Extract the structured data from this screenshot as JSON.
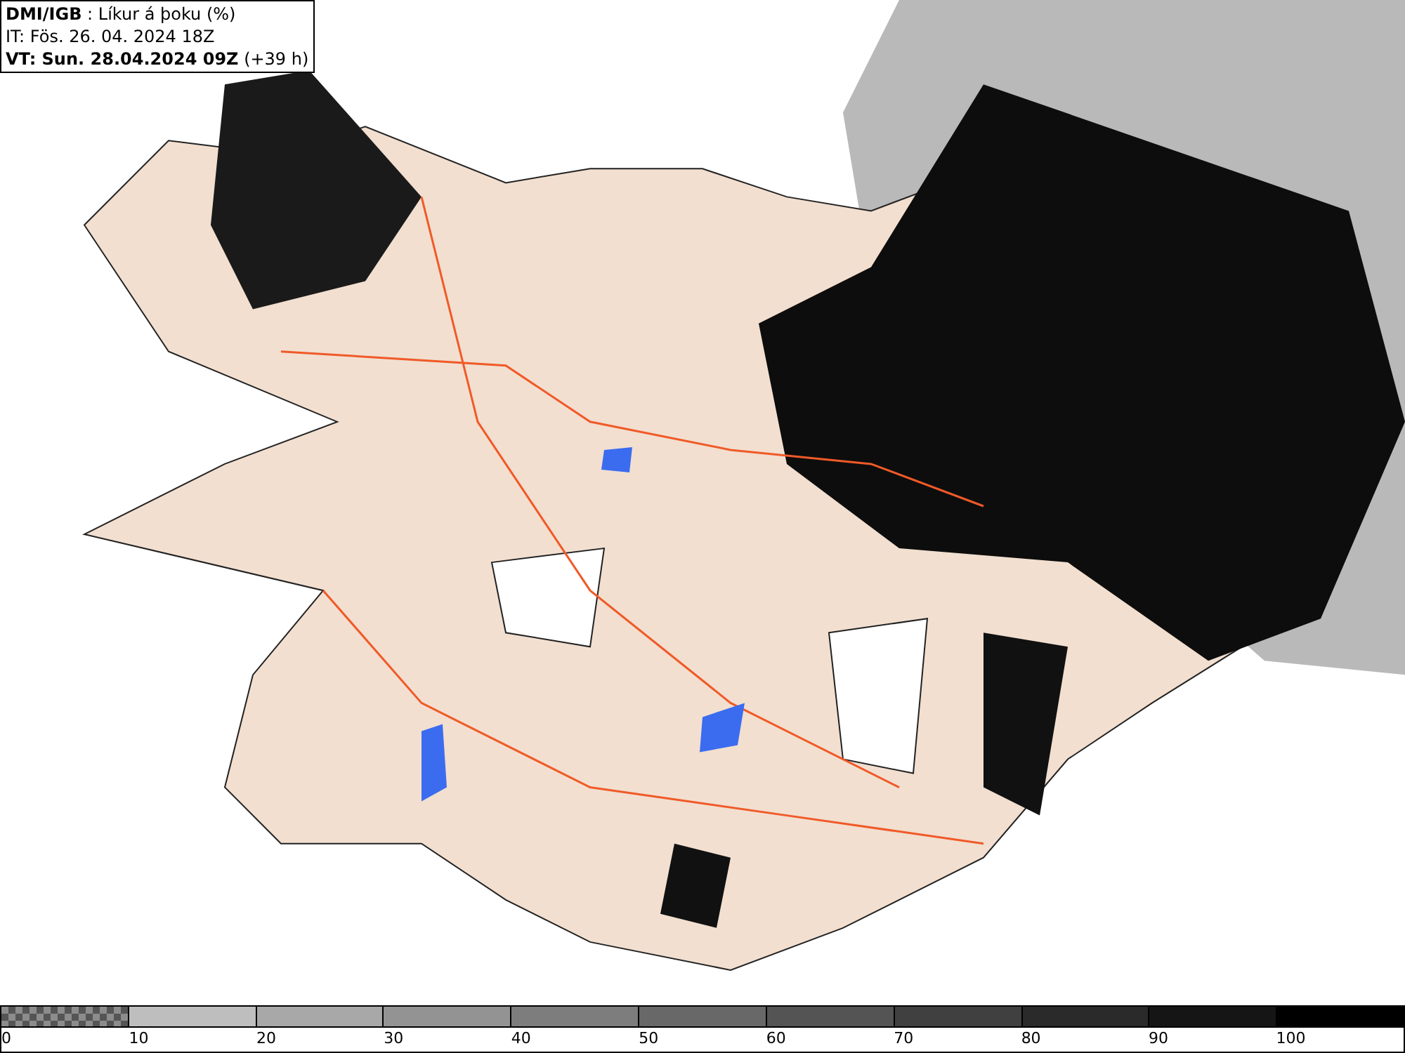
{
  "header": {
    "lines": [
      "**DMI/IGB** : Líkur á þoku (%)",
      "IT: Fös. 26. 04. 2024 18Z",
      "**VT: Sun. 28.04.2024 09Z** (+39 h)"
    ]
  },
  "legend": {
    "segments": [
      {
        "kind": "checker",
        "color": "#555555"
      },
      {
        "kind": "solid",
        "color": "#bebebe"
      },
      {
        "kind": "solid",
        "color": "#a8a8a8"
      },
      {
        "kind": "solid",
        "color": "#939393"
      },
      {
        "kind": "solid",
        "color": "#7d7d7d"
      },
      {
        "kind": "solid",
        "color": "#686868"
      },
      {
        "kind": "solid",
        "color": "#545454"
      },
      {
        "kind": "solid",
        "color": "#404040"
      },
      {
        "kind": "solid",
        "color": "#2a2a2a"
      },
      {
        "kind": "solid",
        "color": "#151515"
      },
      {
        "kind": "solid",
        "color": "#000000"
      }
    ],
    "labels": [
      "0",
      "10",
      "20",
      "30",
      "40",
      "50",
      "60",
      "70",
      "80",
      "90",
      "100"
    ]
  }
}
